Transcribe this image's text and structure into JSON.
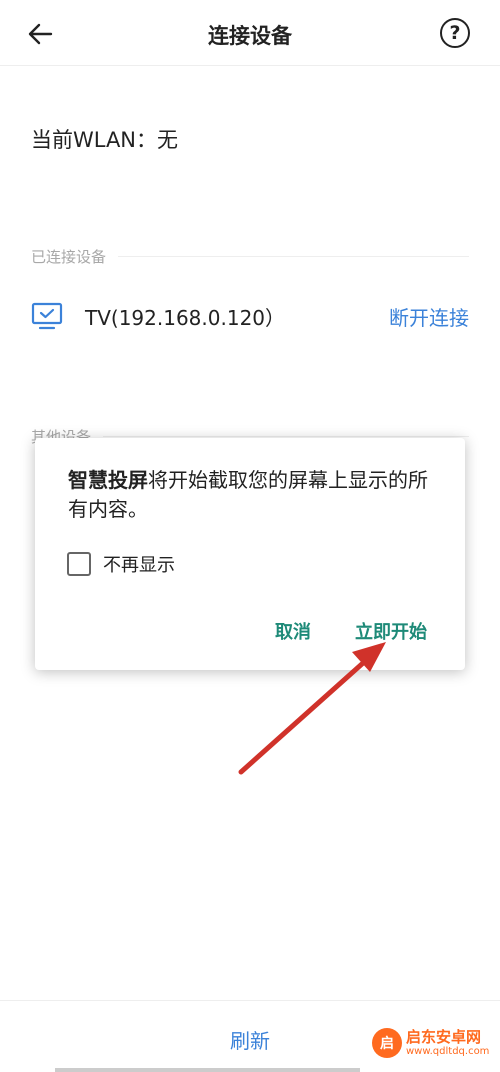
{
  "header": {
    "title": "连接设备",
    "back_icon": "arrow-left-icon",
    "help_icon": "question-circle-icon",
    "help_glyph": "?"
  },
  "wlan": {
    "label": "当前WLAN：",
    "value": "无"
  },
  "connected_section": {
    "label": "已连接设备",
    "device": {
      "icon": "tv-monitor-icon",
      "name": "TV(192.168.0.120）",
      "action": "断开连接"
    }
  },
  "other_section": {
    "label": "其他设备"
  },
  "dialog": {
    "app_name": "智慧投屏",
    "message": "将开始截取您的屏幕上显示的所有内容。",
    "checkbox_label": "不再显示",
    "checkbox_checked": false,
    "cancel_label": "取消",
    "start_label": "立即开始"
  },
  "bottom": {
    "refresh_label": "刷新"
  },
  "watermark": {
    "logo_glyph": "启",
    "title": "启东安卓网",
    "url": "www.qdltdq.com"
  },
  "colors": {
    "accent_blue": "#3b82d9",
    "dialog_button": "#1e8a78",
    "annotation_arrow": "#d0322a",
    "watermark": "#ff6a1f"
  }
}
